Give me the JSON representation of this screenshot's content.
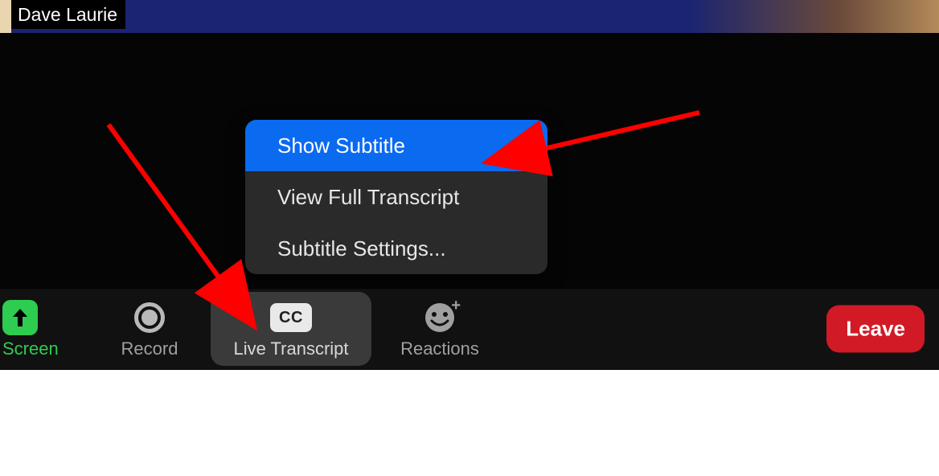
{
  "participant": {
    "name": "Dave Laurie"
  },
  "menu": {
    "items": [
      {
        "label": "Show Subtitle",
        "highlighted": true
      },
      {
        "label": "View Full Transcript",
        "highlighted": false
      },
      {
        "label": "Subtitle Settings...",
        "highlighted": false
      }
    ]
  },
  "toolbar": {
    "share_label": "re Screen",
    "record_label": "Record",
    "transcript_label": "Live Transcript",
    "cc_text": "CC",
    "reactions_label": "Reactions",
    "leave_label": "Leave"
  },
  "colors": {
    "highlight": "#0a6af0",
    "share_green": "#2ecc4f",
    "leave_red": "#d11a26",
    "arrow_red": "#ff0000"
  }
}
